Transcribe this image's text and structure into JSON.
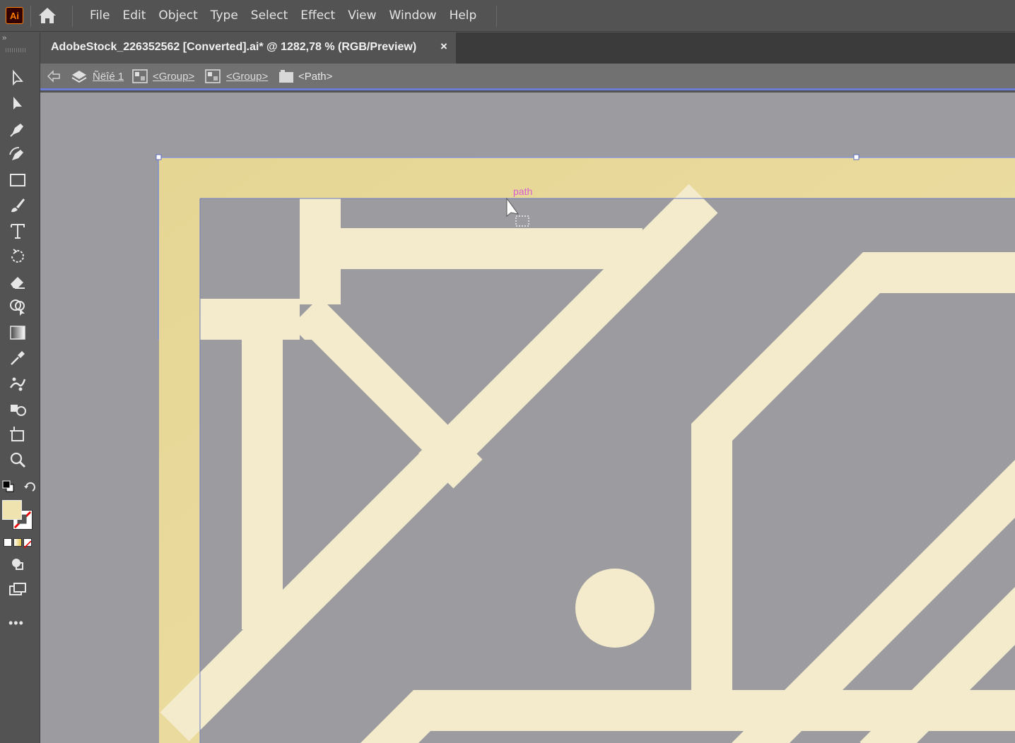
{
  "app": {
    "logo_text": "Ai"
  },
  "menu": {
    "items": [
      "File",
      "Edit",
      "Object",
      "Type",
      "Select",
      "Effect",
      "View",
      "Window",
      "Help"
    ]
  },
  "toolbar": {
    "collapse": "››",
    "tools": [
      "selection-tool",
      "direct-selection-tool",
      "pen-tool",
      "curvature-tool",
      "rectangle-tool",
      "paintbrush-tool",
      "type-tool",
      "rotate-tool",
      "eraser-tool",
      "shape-builder-tool",
      "gradient-tool",
      "eyedropper-tool",
      "puppet-warp-tool",
      "symbol-sprayer-tool",
      "artboard-tool",
      "zoom-tool"
    ],
    "more": "•••"
  },
  "document": {
    "tab_title": "AdobeStock_226352562 [Converted].ai* @ 1282,78 % (RGB/Preview)",
    "close": "×"
  },
  "isolation": {
    "layer": "Ñëîé 1",
    "group1": "<Group>",
    "group2": "<Group>",
    "path": "<Path>"
  },
  "canvas": {
    "smart_guide_label": "path",
    "background": "#9c9ba0",
    "frame_color": "#e8d89a",
    "pattern_color": "#f3ebcb"
  },
  "colors": {
    "fill": "#efe3b0",
    "accent": "#6a7ed8",
    "smart_guide": "#d65fd0"
  }
}
